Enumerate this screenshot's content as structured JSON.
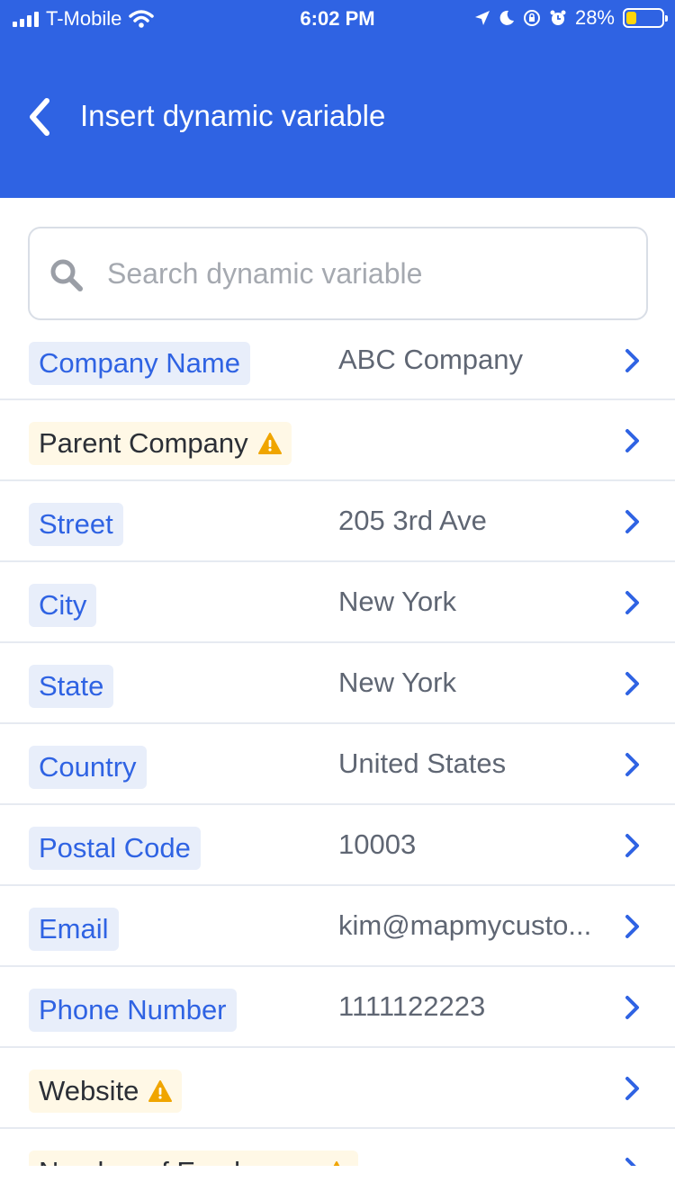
{
  "status_bar": {
    "carrier": "T-Mobile",
    "time": "6:02 PM",
    "battery": "28%",
    "battery_level": 0.28,
    "icons": [
      "signal-icon",
      "wifi-icon",
      "location-icon",
      "moon-icon",
      "rotation-lock-icon",
      "alarm-icon",
      "battery-icon"
    ]
  },
  "nav": {
    "title": "Insert dynamic variable",
    "back_icon": "chevron-left-icon"
  },
  "search": {
    "placeholder": "Search dynamic variable",
    "value": ""
  },
  "colors": {
    "brand": "#2f63e3",
    "tag_bg": "#e8eefa",
    "warn_tag_bg": "#fff8e6",
    "warning": "#f0a500"
  },
  "rows": [
    {
      "label": "Company Name",
      "value": "ABC Company",
      "warning": false
    },
    {
      "label": "Parent Company",
      "value": "",
      "warning": true
    },
    {
      "label": "Street",
      "value": "205 3rd Ave",
      "warning": false
    },
    {
      "label": "City",
      "value": "New York",
      "warning": false
    },
    {
      "label": "State",
      "value": "New York",
      "warning": false
    },
    {
      "label": "Country",
      "value": "United States",
      "warning": false
    },
    {
      "label": "Postal Code",
      "value": "10003",
      "warning": false
    },
    {
      "label": "Email",
      "value": "kim@mapmycusto...",
      "warning": false
    },
    {
      "label": "Phone Number",
      "value": "1111122223",
      "warning": false
    },
    {
      "label": "Website",
      "value": "",
      "warning": true
    },
    {
      "label": "Number of Employees",
      "value": "",
      "warning": true
    }
  ]
}
